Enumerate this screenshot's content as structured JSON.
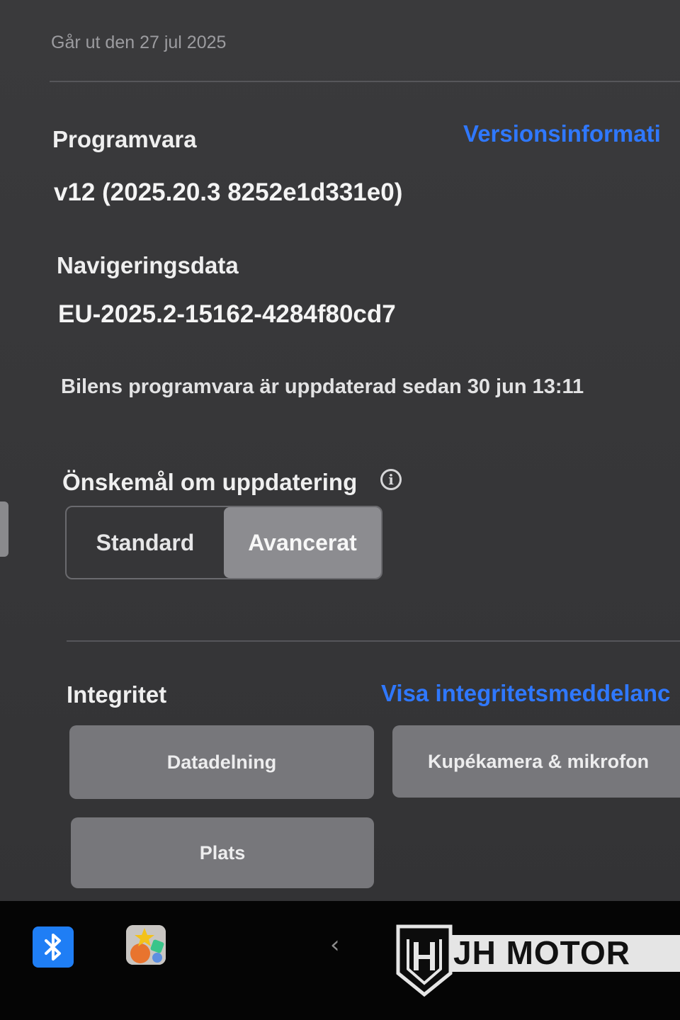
{
  "expiry_text": "Går ut den 27 jul 2025",
  "software": {
    "heading": "Programvara",
    "version": "v12 (2025.20.3 8252e1d331e0)",
    "release_notes_link": "Versionsinformati"
  },
  "navigation": {
    "heading": "Navigeringsdata",
    "value": "EU-2025.2-15162-4284f80cd7"
  },
  "update_status": "Bilens programvara är uppdaterad sedan 30 jun 13:11",
  "update_preference": {
    "heading": "Önskemål om uppdatering",
    "info_glyph": "i",
    "options": [
      "Standard",
      "Avancerat"
    ],
    "selected": "Avancerat"
  },
  "privacy": {
    "heading": "Integritet",
    "notice_link": "Visa integritetsmeddelanc",
    "buttons": {
      "data_sharing": "Datadelning",
      "cabin_camera": "Kupékamera & mikrofon",
      "location": "Plats"
    }
  },
  "taskbar": {
    "chevron": "‹",
    "brand": "JH MOTOR"
  },
  "colors": {
    "background": "#3b3b3d",
    "link": "#2f78ff",
    "selected_segment": "#8c8c90",
    "tile": "#77777b",
    "taskbar": "#050505",
    "bluetooth": "#1f7ef5"
  },
  "icons": [
    "info-icon",
    "bluetooth-icon",
    "toybox-app-icon",
    "chevron-left-icon",
    "jh-motor-logo"
  ]
}
